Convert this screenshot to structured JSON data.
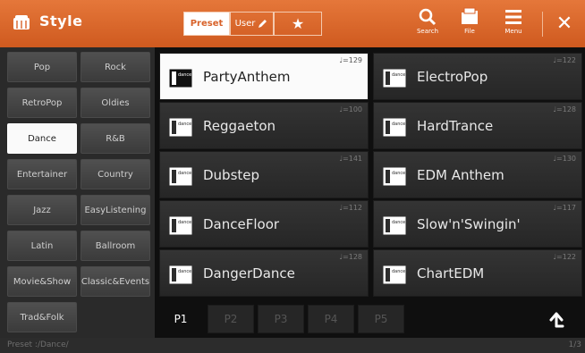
{
  "header": {
    "title": "Style",
    "tabs": {
      "preset": "Preset",
      "user": "User"
    },
    "tools": {
      "search": "Search",
      "file": "File",
      "menu": "Menu"
    }
  },
  "categories": [
    "Pop",
    "Rock",
    "RetroPop",
    "Oldies",
    "Dance",
    "R&B",
    "Entertainer",
    "Country",
    "Jazz",
    "EasyListening",
    "Latin",
    "Ballroom",
    "Movie&Show",
    "Classic&Events",
    "Trad&Folk"
  ],
  "selected_category": "Dance",
  "styles": [
    {
      "name": "PartyAnthem",
      "tempo": "♩=129",
      "selected": true
    },
    {
      "name": "ElectroPop",
      "tempo": "♩=122"
    },
    {
      "name": "Reggaeton",
      "tempo": "♩=100"
    },
    {
      "name": "HardTrance",
      "tempo": "♩=128"
    },
    {
      "name": "Dubstep",
      "tempo": "♩=141"
    },
    {
      "name": "EDM Anthem",
      "tempo": "♩=130"
    },
    {
      "name": "DanceFloor",
      "tempo": "♩=112"
    },
    {
      "name": "Slow'n'Swingin'",
      "tempo": "♩=117"
    },
    {
      "name": "DangerDance",
      "tempo": "♩=128"
    },
    {
      "name": "ChartEDM",
      "tempo": "♩=122"
    }
  ],
  "style_icon_label": "dance",
  "pages": [
    "P1",
    "P2",
    "P3",
    "P4",
    "P5"
  ],
  "active_page": "P1",
  "status": {
    "path": "Preset :/Dance/",
    "page_count": "1/3"
  }
}
